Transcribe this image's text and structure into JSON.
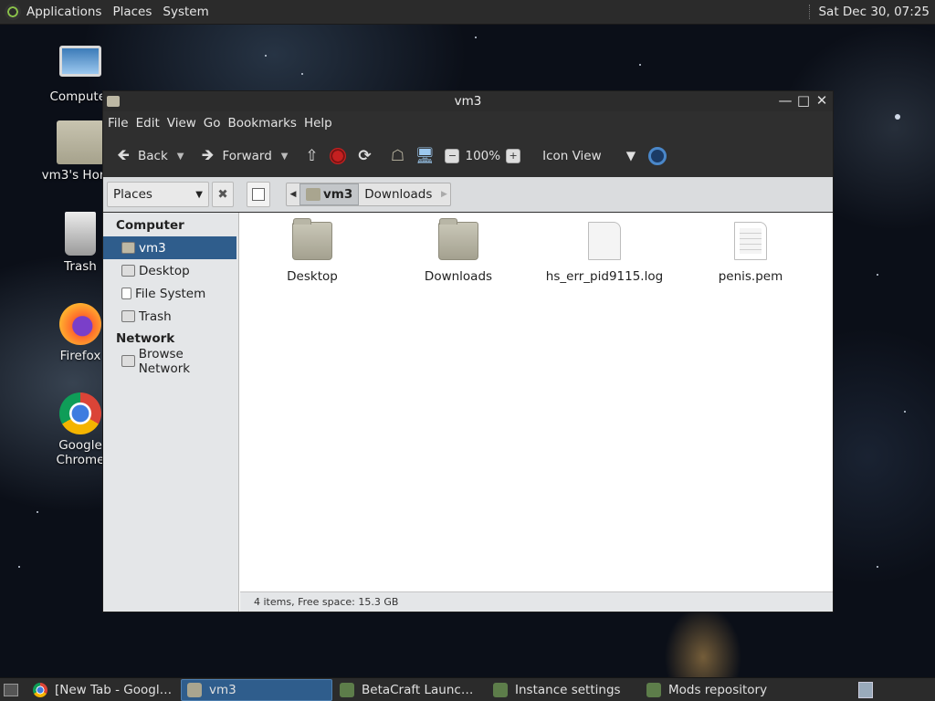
{
  "top_panel": {
    "menus": [
      "Applications",
      "Places",
      "System"
    ],
    "clock": "Sat Dec 30, 07:25"
  },
  "desktop_icons": [
    {
      "label": "Computer",
      "icon": "computer-icon"
    },
    {
      "label": "vm3's Home",
      "icon": "home-folder-icon"
    },
    {
      "label": "Trash",
      "icon": "trash-icon"
    },
    {
      "label": "Firefox",
      "icon": "firefox-icon"
    },
    {
      "label": "Google Chrome",
      "icon": "chrome-icon"
    }
  ],
  "window": {
    "title": "vm3",
    "menus": [
      "File",
      "Edit",
      "View",
      "Go",
      "Bookmarks",
      "Help"
    ],
    "toolbar": {
      "back": "Back",
      "forward": "Forward",
      "zoom": "100%",
      "view_mode": "Icon View"
    },
    "location": {
      "side_pane": "Places",
      "crumbs": [
        "vm3",
        "Downloads"
      ]
    },
    "sidebar": {
      "sections": [
        {
          "heading": "Computer",
          "items": [
            "vm3",
            "Desktop",
            "File System",
            "Trash"
          ]
        },
        {
          "heading": "Network",
          "items": [
            "Browse Network"
          ]
        }
      ]
    },
    "files": [
      {
        "name": "Desktop",
        "kind": "folder"
      },
      {
        "name": "Downloads",
        "kind": "folder"
      },
      {
        "name": "hs_err_pid9115.log",
        "kind": "file"
      },
      {
        "name": "penis.pem",
        "kind": "text-file"
      }
    ],
    "status": "4 items, Free space: 15.3 GB"
  },
  "taskbar": {
    "tasks": [
      {
        "label": "[New Tab - Google ...",
        "icon": "chrome-icon",
        "active": false
      },
      {
        "label": "vm3",
        "icon": "home-folder-icon",
        "active": true
      },
      {
        "label": "BetaCraft Launcher ...",
        "icon": "betacraft-icon",
        "active": false
      },
      {
        "label": "Instance settings",
        "icon": "betacraft-icon",
        "active": false
      },
      {
        "label": "Mods repository",
        "icon": "betacraft-icon",
        "active": false
      }
    ]
  },
  "colors": {
    "selection": "#2f5d8c",
    "panel": "#2b2b2b"
  }
}
